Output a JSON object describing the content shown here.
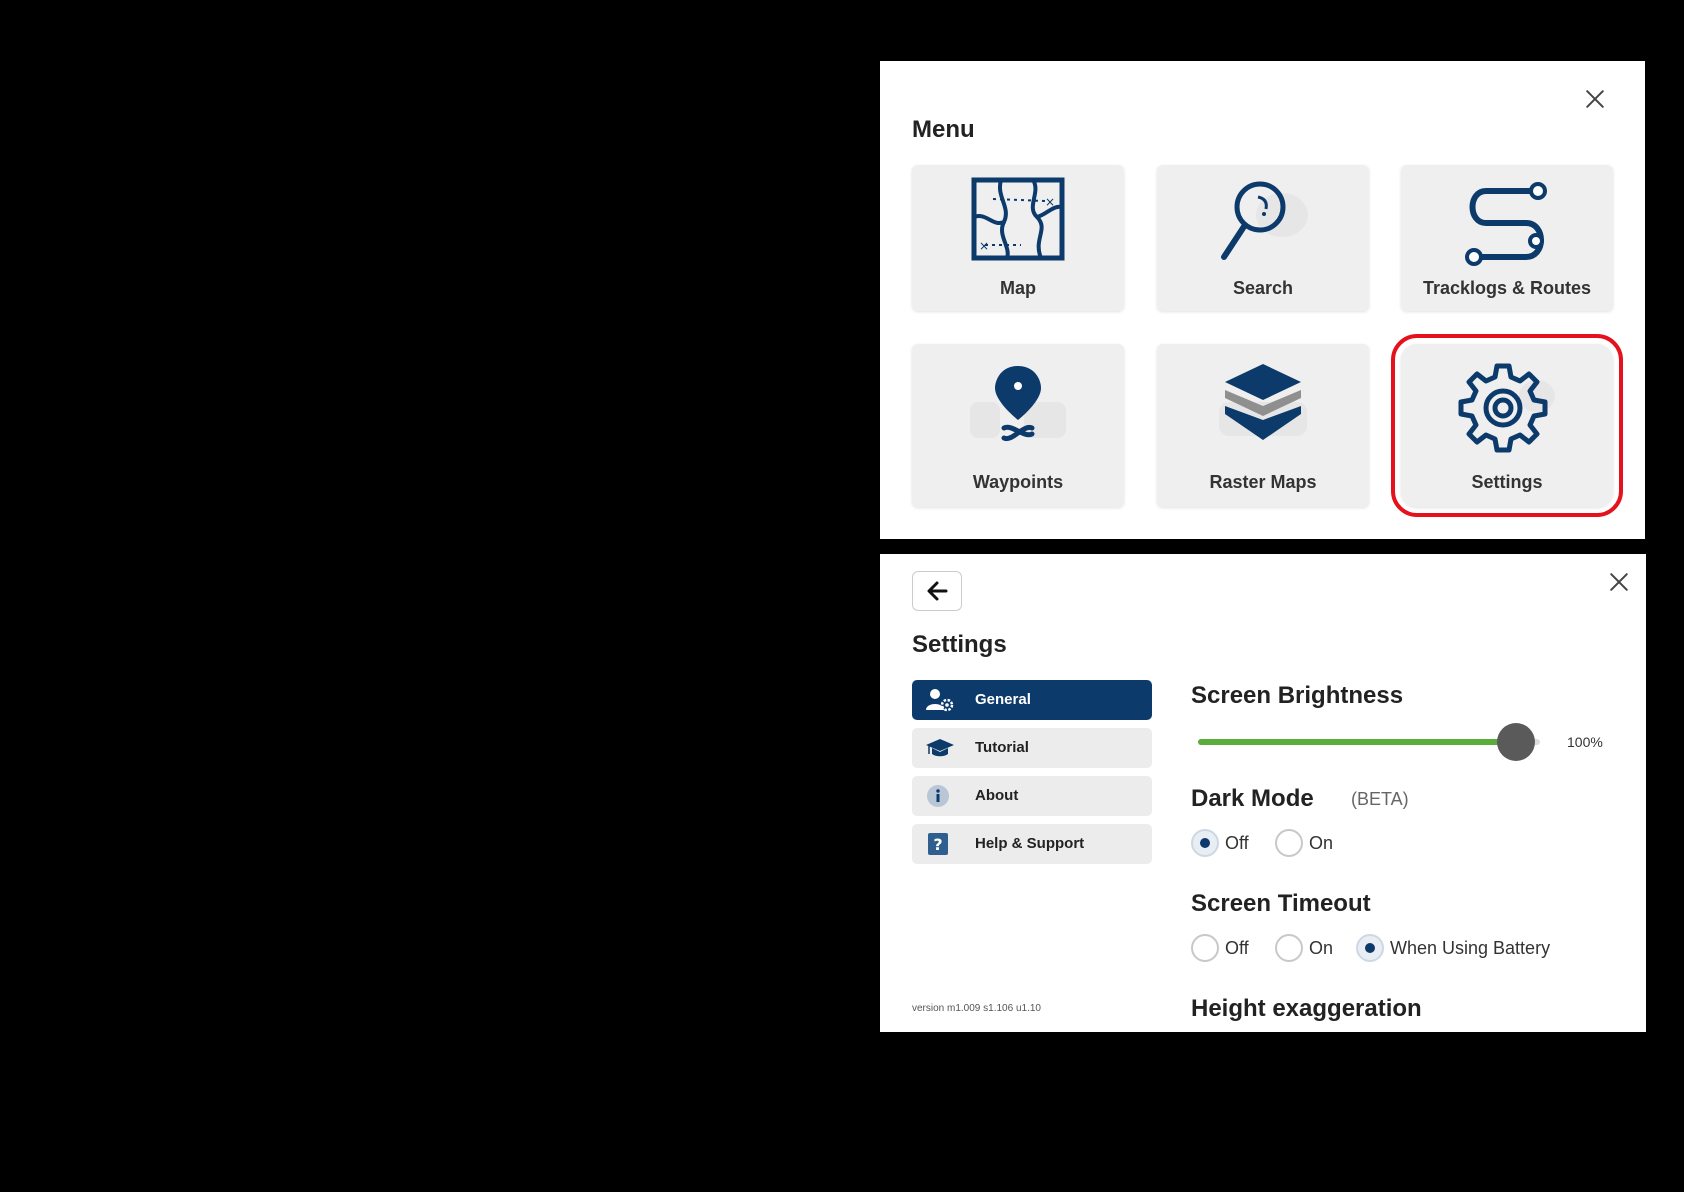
{
  "menu": {
    "title": "Menu",
    "tiles": [
      {
        "label": "Map",
        "icon": "map-icon"
      },
      {
        "label": "Search",
        "icon": "magnifier-icon"
      },
      {
        "label": "Tracklogs & Routes",
        "icon": "route-icon"
      },
      {
        "label": "Waypoints",
        "icon": "waypoint-pin-icon"
      },
      {
        "label": "Raster Maps",
        "icon": "layers-icon"
      },
      {
        "label": "Settings",
        "icon": "gear-icon"
      }
    ],
    "highlighted_tile": "Settings",
    "highlight_color": "#e5121d"
  },
  "settings": {
    "title": "Settings",
    "nav": [
      {
        "label": "General",
        "icon": "user-gear-icon",
        "active": true
      },
      {
        "label": "Tutorial",
        "icon": "graduation-cap-icon",
        "active": false
      },
      {
        "label": "About",
        "icon": "info-icon",
        "active": false
      },
      {
        "label": "Help & Support",
        "icon": "question-icon",
        "active": false
      }
    ],
    "version": "version m1.009 s1.106 u1.10",
    "brightness": {
      "title": "Screen Brightness",
      "value": 100,
      "value_label": "100%"
    },
    "dark_mode": {
      "title": "Dark Mode",
      "badge": "(BETA)",
      "options": [
        "Off",
        "On"
      ],
      "selected": "Off"
    },
    "screen_timeout": {
      "title": "Screen Timeout",
      "options": [
        "Off",
        "On",
        "When Using Battery"
      ],
      "selected": "When Using Battery"
    },
    "height_exaggeration": {
      "title": "Height exaggeration"
    }
  },
  "colors": {
    "brand_navy": "#0c3a6b",
    "slider_green": "#5aac3b"
  }
}
